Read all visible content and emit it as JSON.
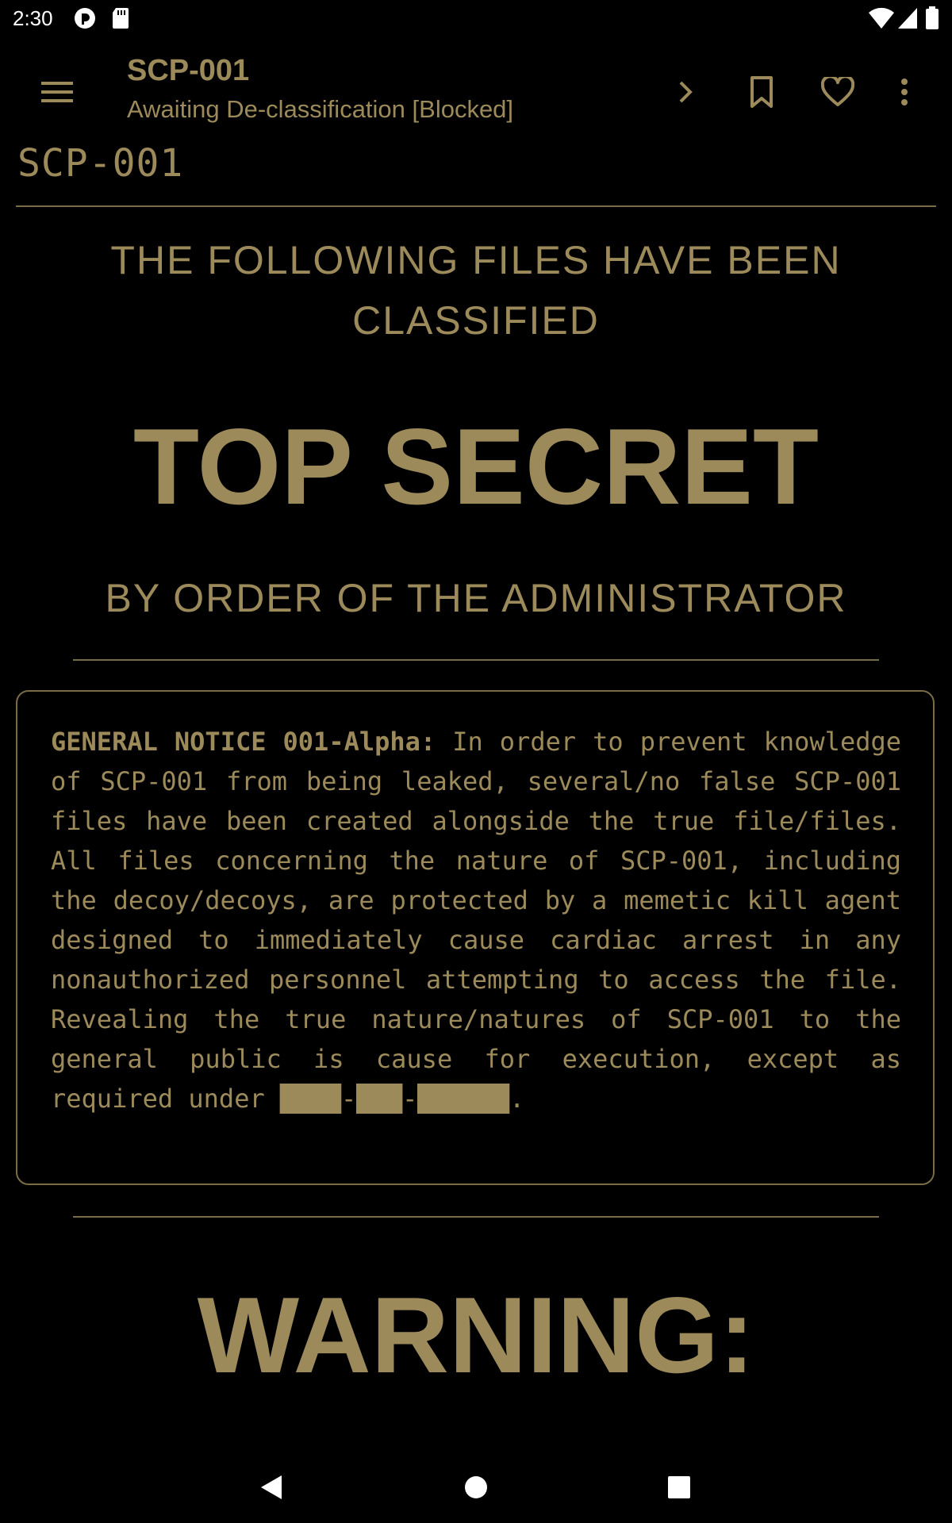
{
  "status_bar": {
    "time": "2:30",
    "icons": [
      "pocketcasts-icon",
      "sd-card-icon",
      "wifi-icon",
      "cell-signal-icon",
      "battery-icon"
    ]
  },
  "app_bar": {
    "title": "SCP-001",
    "subtitle": "Awaiting De-classification [Blocked]",
    "icons": [
      "menu-icon",
      "chevron-right-icon",
      "bookmark-icon",
      "heart-icon",
      "more-vert-icon"
    ]
  },
  "article": {
    "heading": "SCP-001",
    "classified_line": "THE FOLLOWING FILES HAVE BEEN CLASSIFIED",
    "top_secret": "TOP SECRET",
    "by_order": "BY ORDER OF THE ADMINISTRATOR",
    "notice": {
      "label": "GENERAL NOTICE 001-Alpha:",
      "body": " In order to prevent knowledge of SCP-001 from being leaked, several/no false SCP-001 files have been created alongside the true file/files. All files concerning the nature of SCP-001, including the decoy/decoys, are protected by a memetic kill agent designed to immediately cause cardiac arrest in any nonauthorized personnel attempting to access the file. Revealing the true nature/natures of SCP-001 to the general public is cause for execution, except as required under ",
      "redacted_1": "████",
      "dash_1": "-",
      "redacted_2": "███",
      "dash_2": "-",
      "redacted_3": "██████",
      "end": "."
    },
    "warning": "WARNING:"
  },
  "colors": {
    "background": "#000000",
    "accent": "#9c8a5b",
    "rule": "#7a6c47"
  },
  "nav_bar": {
    "icons": [
      "back-icon",
      "home-icon",
      "recents-icon"
    ]
  }
}
